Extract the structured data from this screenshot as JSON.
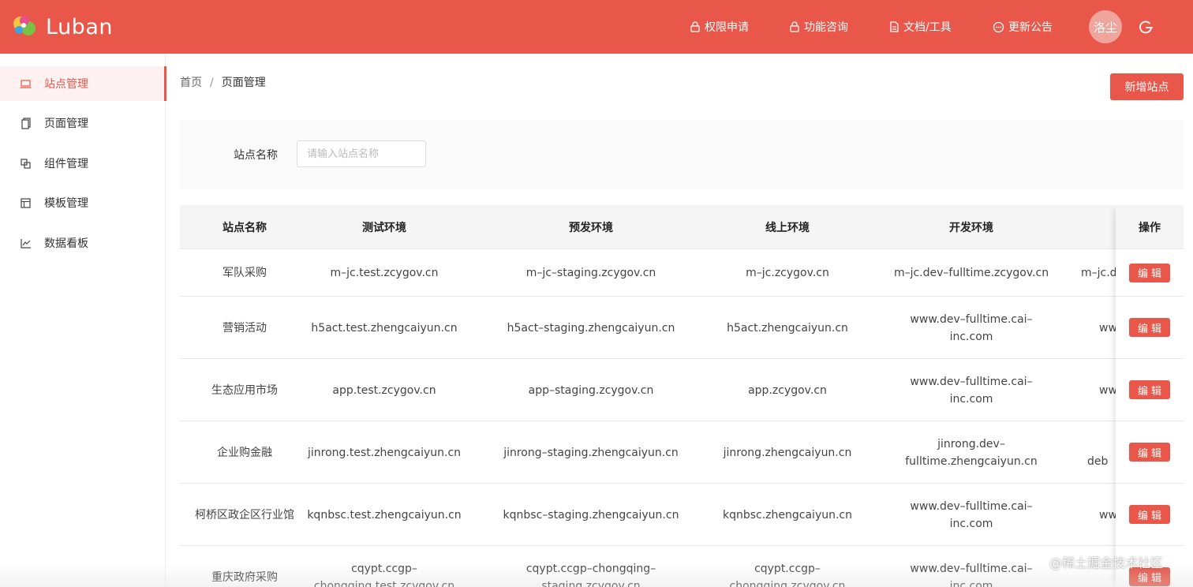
{
  "app": {
    "logo_text": "Luban"
  },
  "header": {
    "nav": [
      {
        "label": "权限申请",
        "icon": "lock-icon"
      },
      {
        "label": "功能咨询",
        "icon": "lock-icon"
      },
      {
        "label": "文档/工具",
        "icon": "document-icon"
      },
      {
        "label": "更新公告",
        "icon": "chat-icon"
      }
    ],
    "user_name": "洛尘",
    "accent_color": "#e8574a"
  },
  "sidebar": {
    "items": [
      {
        "label": "站点管理",
        "icon": "laptop-icon",
        "active": true
      },
      {
        "label": "页面管理",
        "icon": "pages-icon",
        "active": false
      },
      {
        "label": "组件管理",
        "icon": "component-icon",
        "active": false
      },
      {
        "label": "模板管理",
        "icon": "template-icon",
        "active": false
      },
      {
        "label": "数据看板",
        "icon": "chart-icon",
        "active": false
      }
    ]
  },
  "breadcrumb": {
    "home": "首页",
    "separator": "/",
    "current": "页面管理"
  },
  "actions": {
    "new_site": "新增站点"
  },
  "filter": {
    "label": "站点名称",
    "placeholder": "请输入站点名称",
    "value": ""
  },
  "table": {
    "headers": [
      "站点名称",
      "测试环境",
      "预发环境",
      "线上环境",
      "开发环境",
      "操作"
    ],
    "edit_label": "编辑",
    "rows": [
      {
        "name": "军队采购",
        "test": "m–jc.test.zcygov.cn",
        "staging": "m–jc–staging.zcygov.cn",
        "online": "m–jc.zcygov.cn",
        "dev": "m–jc.dev–fulltime.zcygov.cn",
        "extra": "m–jc.d"
      },
      {
        "name": "营销活动",
        "test": "h5act.test.zhengcaiyun.cn",
        "staging": "h5act–staging.zhengcaiyun.cn",
        "online": "h5act.zhengcaiyun.cn",
        "dev": "www.dev–fulltime.cai–inc.com",
        "extra": "ww"
      },
      {
        "name": "生态应用市场",
        "test": "app.test.zcygov.cn",
        "staging": "app–staging.zcygov.cn",
        "online": "app.zcygov.cn",
        "dev": "www.dev–fulltime.cai–inc.com",
        "extra": "ww"
      },
      {
        "name": "企业购金融",
        "test": "jinrong.test.zhengcaiyun.cn",
        "staging": "jinrong–staging.zhengcaiyun.cn",
        "online": "jinrong.zhengcaiyun.cn",
        "dev": "jinrong.dev–fulltime.zhengcaiyun.cn",
        "extra": "deb"
      },
      {
        "name": "柯桥区政企区行业馆",
        "test": "kqnbsc.test.zhengcaiyun.cn",
        "staging": "kqnbsc–staging.zhengcaiyun.cn",
        "online": "kqnbsc.zhengcaiyun.cn",
        "dev": "www.dev–fulltime.cai–inc.com",
        "extra": "ww"
      },
      {
        "name": "重庆政府采购",
        "test": "cqypt.ccgp–chongqing.test.zcygov.cn",
        "staging": "cqypt.ccgp–chongqing–staging.zcygov.cn",
        "online": "cqypt.ccgp–chongqing.zcygov.cn",
        "dev": "www.dev–fulltime.cai–inc.com",
        "extra": ""
      }
    ]
  },
  "watermark": "@稀土掘金技术社区"
}
